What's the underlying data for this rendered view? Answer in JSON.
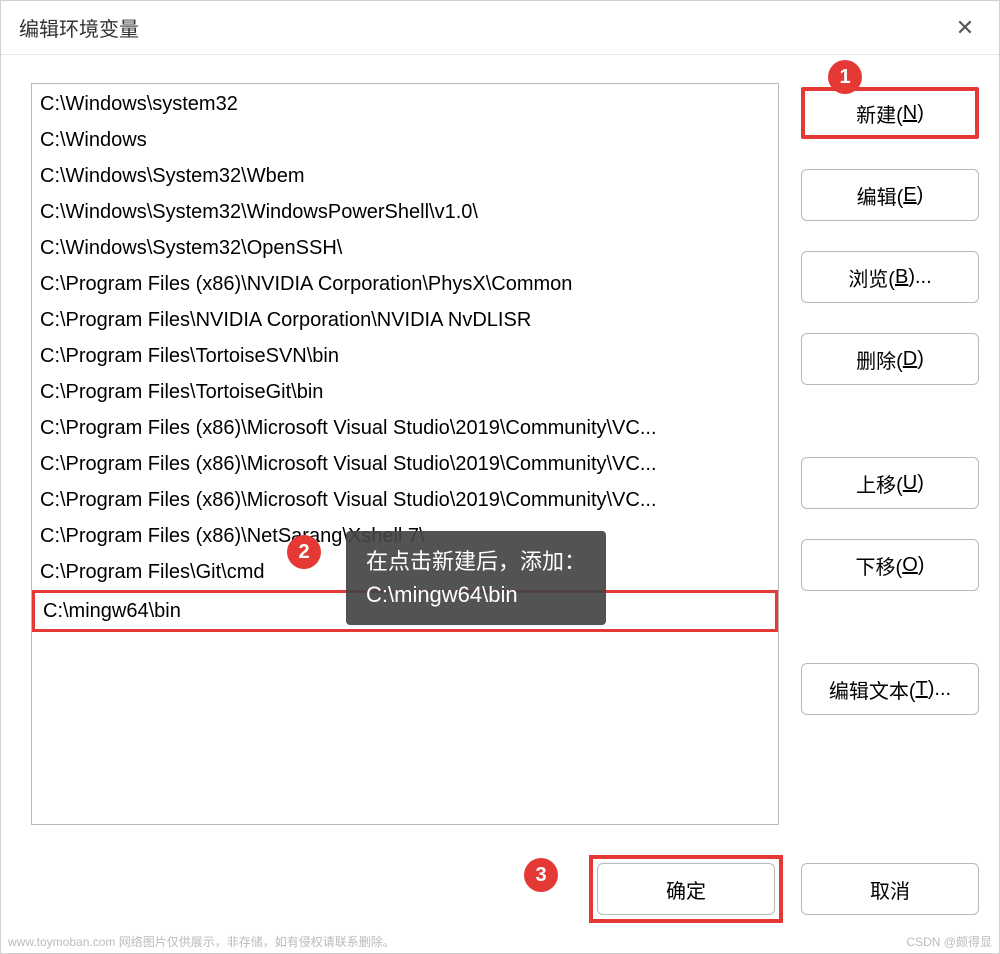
{
  "dialog": {
    "title": "编辑环境变量",
    "close": "✕"
  },
  "paths": [
    "C:\\Windows\\system32",
    "C:\\Windows",
    "C:\\Windows\\System32\\Wbem",
    "C:\\Windows\\System32\\WindowsPowerShell\\v1.0\\",
    "C:\\Windows\\System32\\OpenSSH\\",
    "C:\\Program Files (x86)\\NVIDIA Corporation\\PhysX\\Common",
    "C:\\Program Files\\NVIDIA Corporation\\NVIDIA NvDLISR",
    "C:\\Program Files\\TortoiseSVN\\bin",
    "C:\\Program Files\\TortoiseGit\\bin",
    "C:\\Program Files (x86)\\Microsoft Visual Studio\\2019\\Community\\VC...",
    "C:\\Program Files (x86)\\Microsoft Visual Studio\\2019\\Community\\VC...",
    "C:\\Program Files (x86)\\Microsoft Visual Studio\\2019\\Community\\VC...",
    "C:\\Program Files (x86)\\NetSarang\\Xshell 7\\",
    "C:\\Program Files\\Git\\cmd",
    "C:\\mingw64\\bin"
  ],
  "highlighted_index": 14,
  "buttons": {
    "new_label": "新建(",
    "new_key": "N",
    "new_close": ")",
    "edit_label": "编辑(",
    "edit_key": "E",
    "edit_close": ")",
    "browse_label": "浏览(",
    "browse_key": "B",
    "browse_close": ")...",
    "delete_label": "删除(",
    "delete_key": "D",
    "delete_close": ")",
    "moveup_label": "上移(",
    "moveup_key": "U",
    "moveup_close": ")",
    "movedown_label": "下移(",
    "movedown_key": "O",
    "movedown_close": ")",
    "edittext_label": "编辑文本(",
    "edittext_key": "T",
    "edittext_close": ")..."
  },
  "footer": {
    "ok": "确定",
    "cancel": "取消"
  },
  "markers": {
    "m1": "1",
    "m2": "2",
    "m3": "3"
  },
  "tooltip": {
    "line1": "在点击新建后，添加：",
    "line2": "C:\\mingw64\\bin"
  },
  "watermarks": {
    "left": "www.toymoban.com 网络图片仅供展示，非存储，如有侵权请联系删除。",
    "right": "CSDN @颇得显"
  }
}
